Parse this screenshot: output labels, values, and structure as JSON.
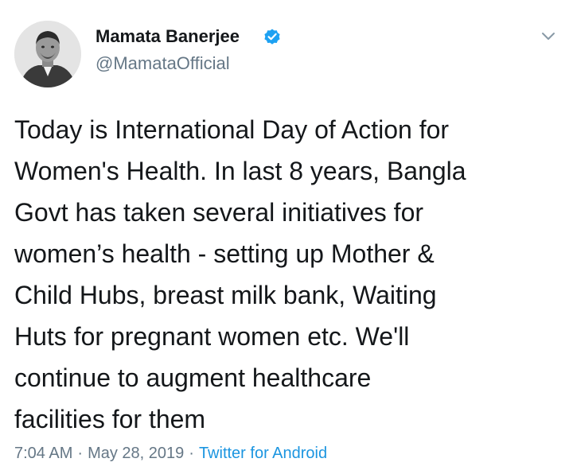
{
  "author": {
    "name": "Mamata Banerjee",
    "handle": "@MamataOfficial",
    "avatar_icon": "portrait-avatar",
    "verified_icon": "verified-badge-icon",
    "verified_color": "#1da1f2"
  },
  "menu": {
    "caret_icon": "chevron-down-icon"
  },
  "tweet": {
    "lines": [
      "Today is International Day of Action for",
      "Women's Health. In last 8 years, Bangla",
      "Govt has taken several initiatives for",
      "women’s health - setting up Mother &",
      "Child Hubs, breast milk bank, Waiting",
      "Huts for pregnant women etc. We'll",
      "continue to augment healthcare",
      "facilities for them"
    ]
  },
  "meta": {
    "time": "7:04 AM",
    "separator": "·",
    "date": "May 28, 2019",
    "source": "Twitter for Android"
  },
  "colors": {
    "text": "#14171a",
    "secondary": "#657786",
    "link": "#1b95e0"
  }
}
